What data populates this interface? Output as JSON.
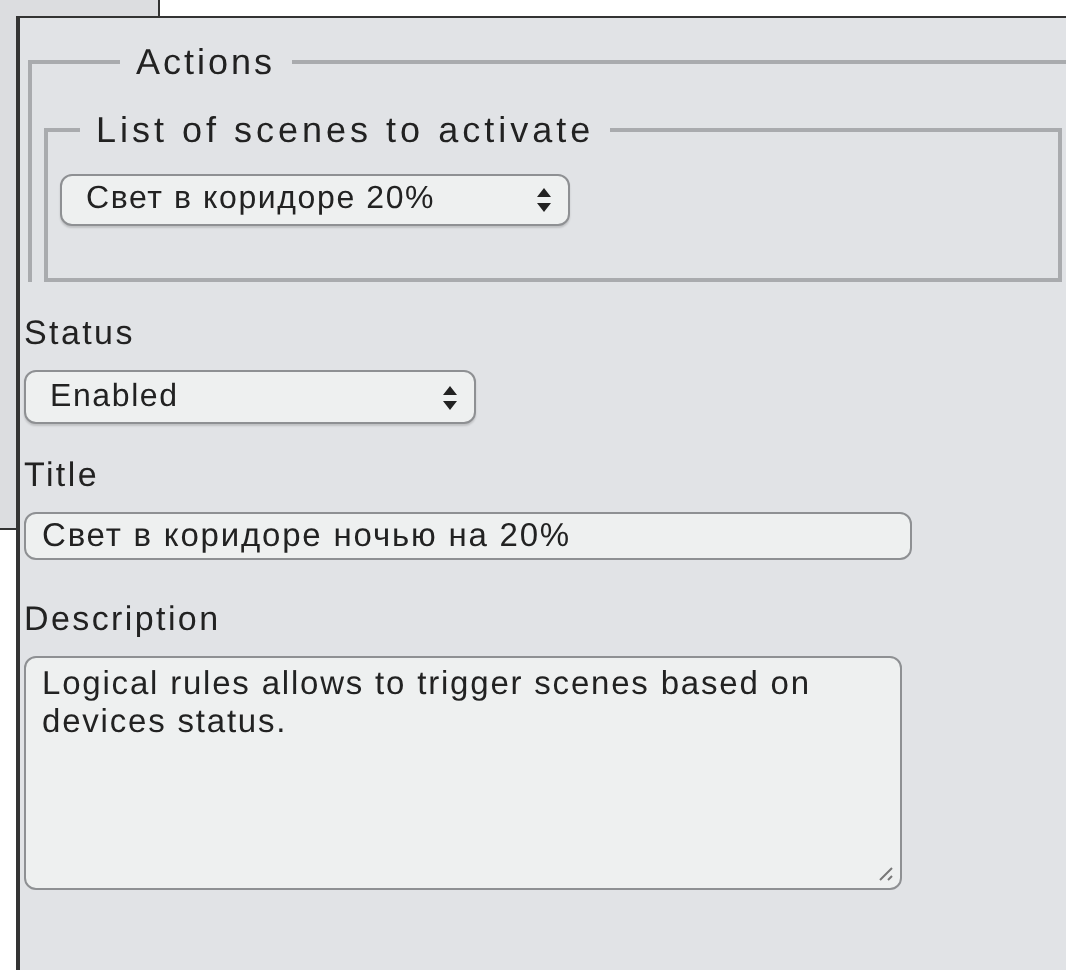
{
  "actions": {
    "legend": "Actions",
    "scenes": {
      "legend": "List of scenes to activate",
      "dropdown": {
        "value": "Свет в коридоре 20%"
      }
    }
  },
  "status": {
    "label": "Status",
    "dropdown": {
      "value": "Enabled"
    }
  },
  "title": {
    "label": "Title",
    "value": "Свет в коридоре ночью на 20%"
  },
  "description": {
    "label": "Description",
    "value": "Logical rules allows to trigger scenes based on devices status."
  }
}
